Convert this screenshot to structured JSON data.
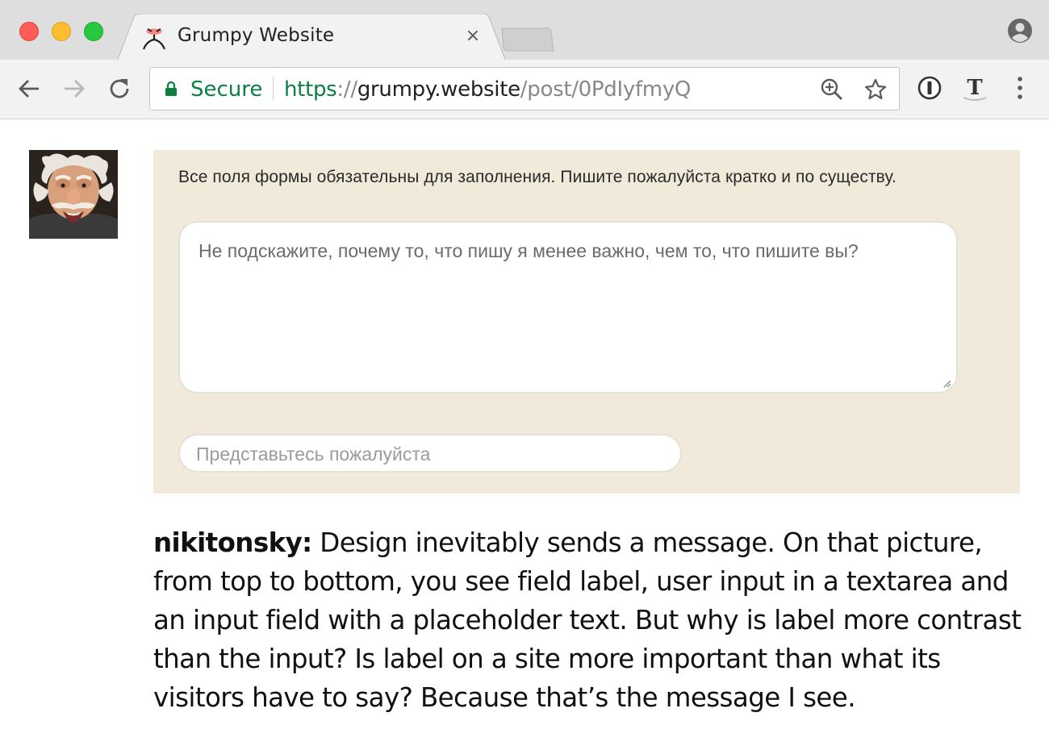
{
  "browser": {
    "tab": {
      "title": "Grumpy Website",
      "close_glyph": "×",
      "favicon": "grumpy-face-icon"
    },
    "address_bar": {
      "security_label": "Secure",
      "url_scheme": "https",
      "url_separator": "://",
      "url_host": "grumpy.website",
      "url_path": "/post/0PdIyfmyQ"
    },
    "icons": {
      "back": "arrow-left-icon",
      "forward": "arrow-right-icon",
      "reload": "reload-icon",
      "zoom": "zoom-in-icon",
      "bookmark": "star-icon",
      "extension_1": "onepassword-icon",
      "extension_2": "typeface-icon",
      "menu": "kebab-menu-icon",
      "profile": "profile-icon"
    },
    "colors": {
      "secure_green": "#0b8043",
      "chrome_bg": "#dedede",
      "toolbar_bg": "#f2f2f2"
    }
  },
  "post": {
    "screenshot": {
      "form_label": "Все поля формы обязательны для заполнения. Пишите пожалуйста кратко и по существу.",
      "textarea_value": "Не подскажите, почему то, что пишу я менее важно, чем то, что пишите вы?",
      "input_placeholder": "Представьтесь пожалуйста",
      "background_color": "#f1eadb"
    },
    "comment": {
      "author": "nikitonsky:",
      "text": " Design inevitably sends a message. On that picture, from top to bottom, you see field label, user input in a textarea and an input field with a placeholder text. But why is label more contrast than the input? Is label on a site more important than what its visitors have to say? Because that’s the message I see."
    }
  }
}
